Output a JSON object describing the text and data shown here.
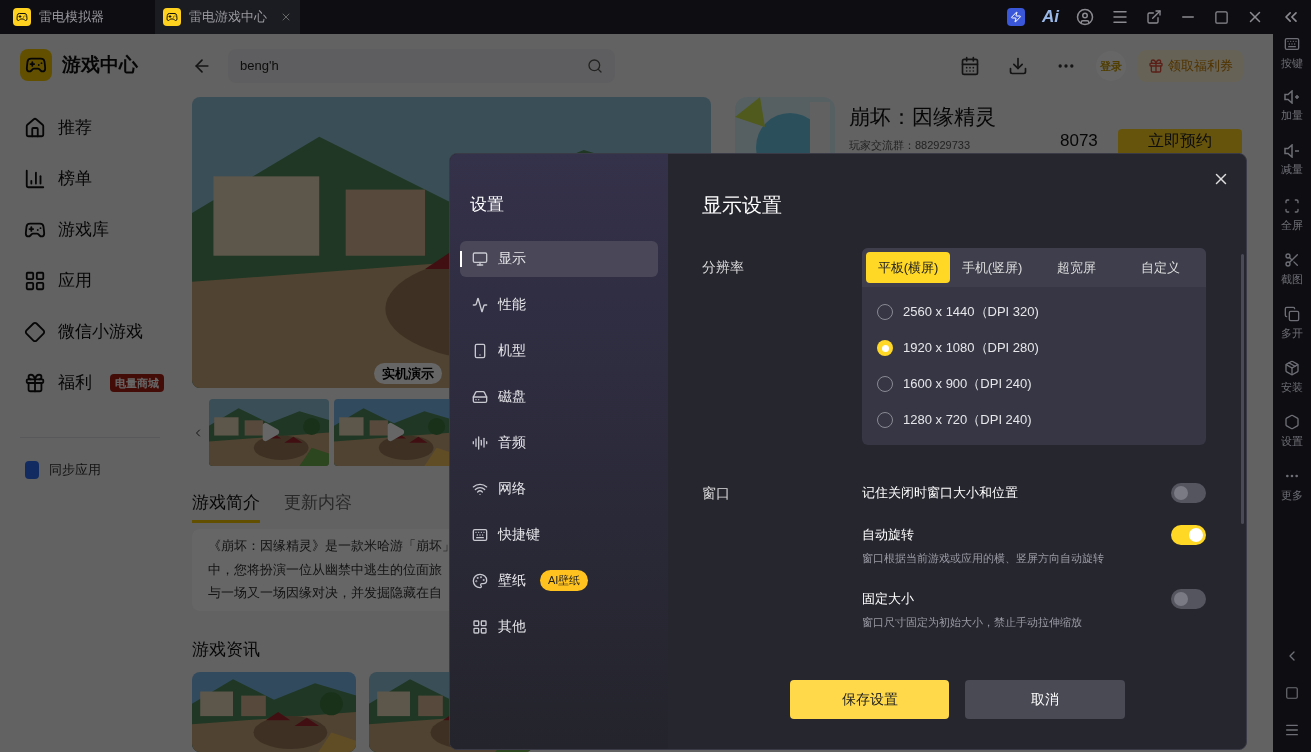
{
  "title_bar": {
    "tabs": [
      {
        "label": "雷电模拟器",
        "selected": false,
        "closable": false
      },
      {
        "label": "雷电游戏中心",
        "selected": true,
        "closable": true
      }
    ],
    "ai_logo": "Ai"
  },
  "sidebar": {
    "brand": "游戏中心",
    "items": [
      {
        "label": "推荐",
        "kind": "home"
      },
      {
        "label": "榜单",
        "kind": "chart"
      },
      {
        "label": "游戏库",
        "kind": "gamepad"
      },
      {
        "label": "应用",
        "kind": "apps"
      },
      {
        "label": "微信小游戏",
        "kind": "diamond"
      },
      {
        "label": "福利",
        "kind": "gift",
        "badge": "电量商城"
      }
    ],
    "sync": "同步应用"
  },
  "header": {
    "search_value": "beng'h",
    "login": "登录",
    "coupon": "领取福利券"
  },
  "game": {
    "title": "崩坏：因缘精灵",
    "group": "玩家交流群：882929733",
    "count": "8073",
    "reserve": "立即预约",
    "media_label": "实机演示",
    "tabs": [
      {
        "label": "游戏简介",
        "selected": true
      },
      {
        "label": "更新内容",
        "selected": false
      }
    ],
    "intro_lines": [
      "《崩坏：因缘精灵》是一款米哈游「崩坏」",
      "中，您将扮演一位从幽禁中逃生的位面旅",
      "与一场又一场因缘对决，并发掘隐藏在自"
    ],
    "news_title": "游戏资讯"
  },
  "rail": [
    {
      "label": "按键",
      "kind": "keyboard"
    },
    {
      "label": "加量",
      "kind": "volume-up"
    },
    {
      "label": "减量",
      "kind": "volume-down"
    },
    {
      "label": "全屏",
      "kind": "fullscreen"
    },
    {
      "label": "截图",
      "kind": "scissors"
    },
    {
      "label": "多开",
      "kind": "multi"
    },
    {
      "label": "安装",
      "kind": "install"
    },
    {
      "label": "设置",
      "kind": "settings"
    },
    {
      "label": "更多",
      "kind": "more"
    }
  ],
  "dialog": {
    "title": "设置",
    "heading": "显示设置",
    "menu": [
      {
        "label": "显示",
        "kind": "monitor",
        "selected": true
      },
      {
        "label": "性能",
        "kind": "activity",
        "selected": false
      },
      {
        "label": "机型",
        "kind": "phone",
        "selected": false
      },
      {
        "label": "磁盘",
        "kind": "disk",
        "selected": false
      },
      {
        "label": "音频",
        "kind": "audio",
        "selected": false
      },
      {
        "label": "网络",
        "kind": "wifi",
        "selected": false
      },
      {
        "label": "快捷键",
        "kind": "keyboard",
        "selected": false
      },
      {
        "label": "壁纸",
        "kind": "palette",
        "selected": false,
        "badge": "AI壁纸"
      },
      {
        "label": "其他",
        "kind": "grid",
        "selected": false
      }
    ],
    "resolution": {
      "label": "分辨率",
      "tabs": [
        {
          "label": "平板(横屏)",
          "selected": true
        },
        {
          "label": "手机(竖屏)",
          "selected": false
        },
        {
          "label": "超宽屏",
          "selected": false
        },
        {
          "label": "自定义",
          "selected": false
        }
      ],
      "options": [
        {
          "label": "2560 x 1440（DPI 320)",
          "selected": false
        },
        {
          "label": "1920 x 1080（DPI 280)",
          "selected": true
        },
        {
          "label": "1600 x 900（DPI 240)",
          "selected": false
        },
        {
          "label": "1280 x 720（DPI 240)",
          "selected": false
        }
      ]
    },
    "window": {
      "label": "窗口",
      "toggles": [
        {
          "label": "记住关闭时窗口大小和位置",
          "on": false
        },
        {
          "label": "自动旋转",
          "on": true,
          "description": "窗口根据当前游戏或应用的横、竖屏方向自动旋转"
        },
        {
          "label": "固定大小",
          "on": false,
          "description": "窗口尺寸固定为初始大小，禁止手动拉伸缩放"
        }
      ]
    },
    "save": "保存设置",
    "cancel": "取消"
  }
}
